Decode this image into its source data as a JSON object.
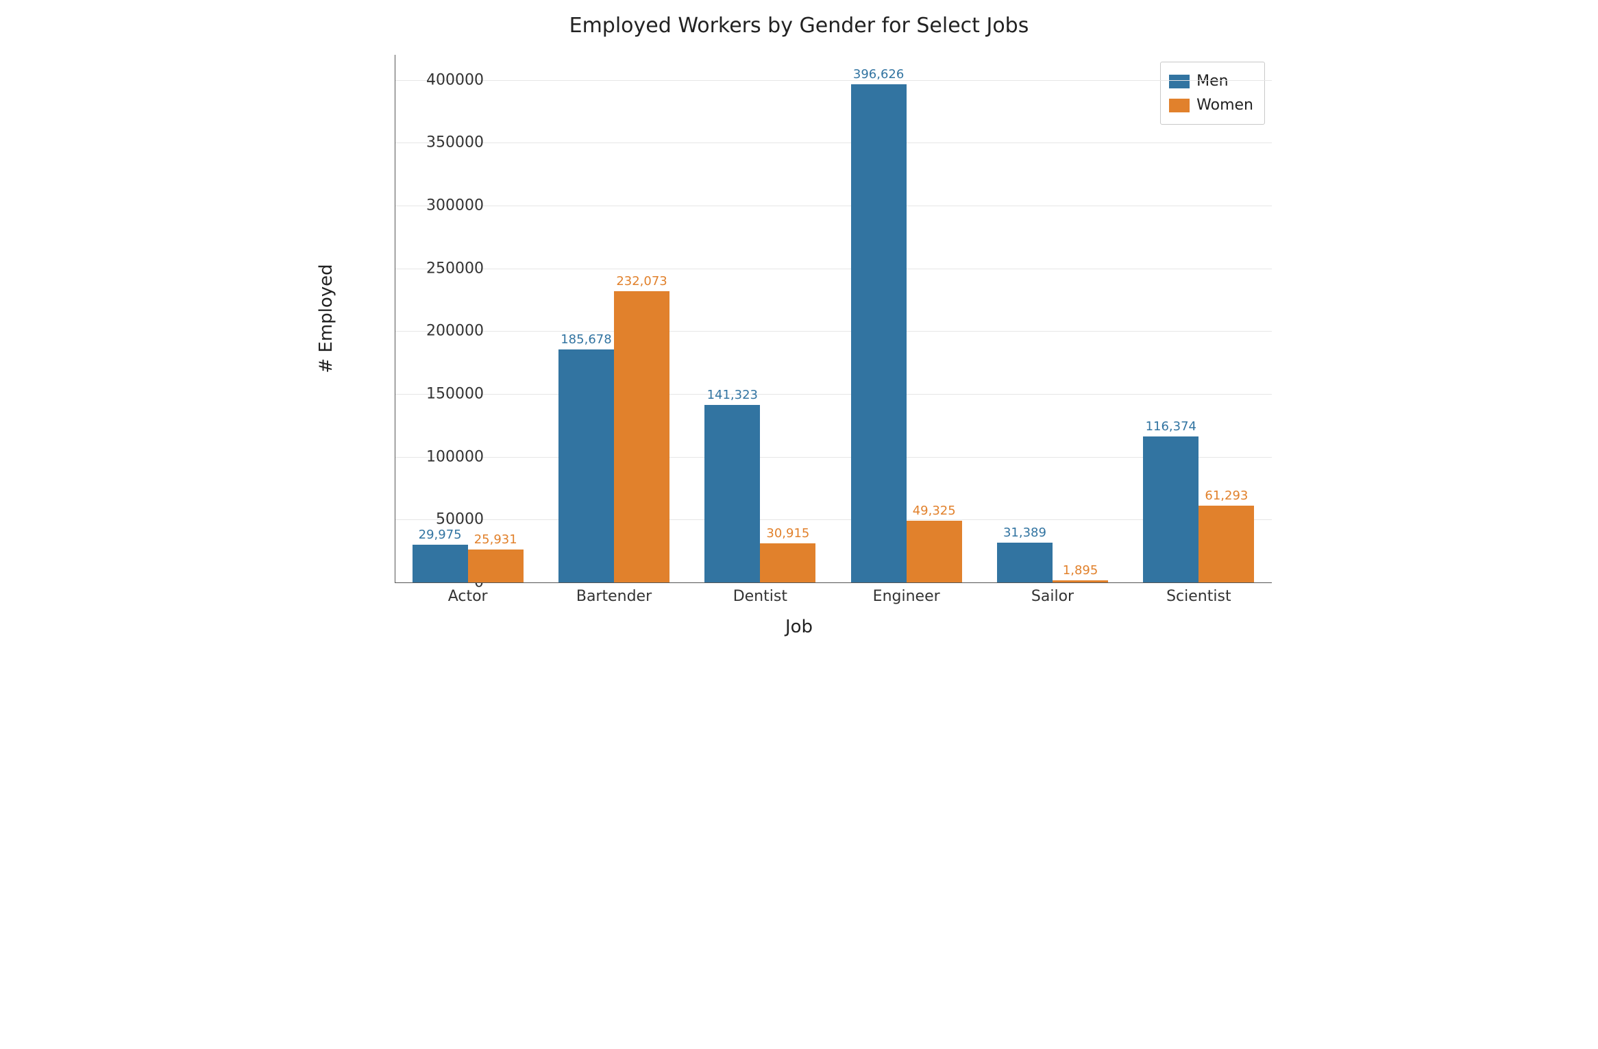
{
  "chart_data": {
    "type": "bar",
    "title": "Employed Workers by Gender for Select Jobs",
    "xlabel": "Job",
    "ylabel": "# Employed",
    "ylim": [
      0,
      420000
    ],
    "yticks": [
      0,
      50000,
      100000,
      150000,
      200000,
      250000,
      300000,
      350000,
      400000
    ],
    "ytick_labels": [
      "0",
      "50000",
      "100000",
      "150000",
      "200000",
      "250000",
      "300000",
      "350000",
      "400000"
    ],
    "categories": [
      "Actor",
      "Bartender",
      "Dentist",
      "Engineer",
      "Sailor",
      "Scientist"
    ],
    "series": [
      {
        "name": "Men",
        "color": "#3274a1",
        "values": [
          29975,
          185678,
          141323,
          396626,
          31389,
          116374
        ],
        "value_labels": [
          "29,975",
          "185,678",
          "141,323",
          "396,626",
          "31,389",
          "116,374"
        ]
      },
      {
        "name": "Women",
        "color": "#e1812c",
        "values": [
          25931,
          232073,
          30915,
          49325,
          1895,
          61293
        ],
        "value_labels": [
          "25,931",
          "232,073",
          "30,915",
          "49,325",
          "1,895",
          "61,293"
        ]
      }
    ],
    "legend": [
      "Men",
      "Women"
    ]
  }
}
